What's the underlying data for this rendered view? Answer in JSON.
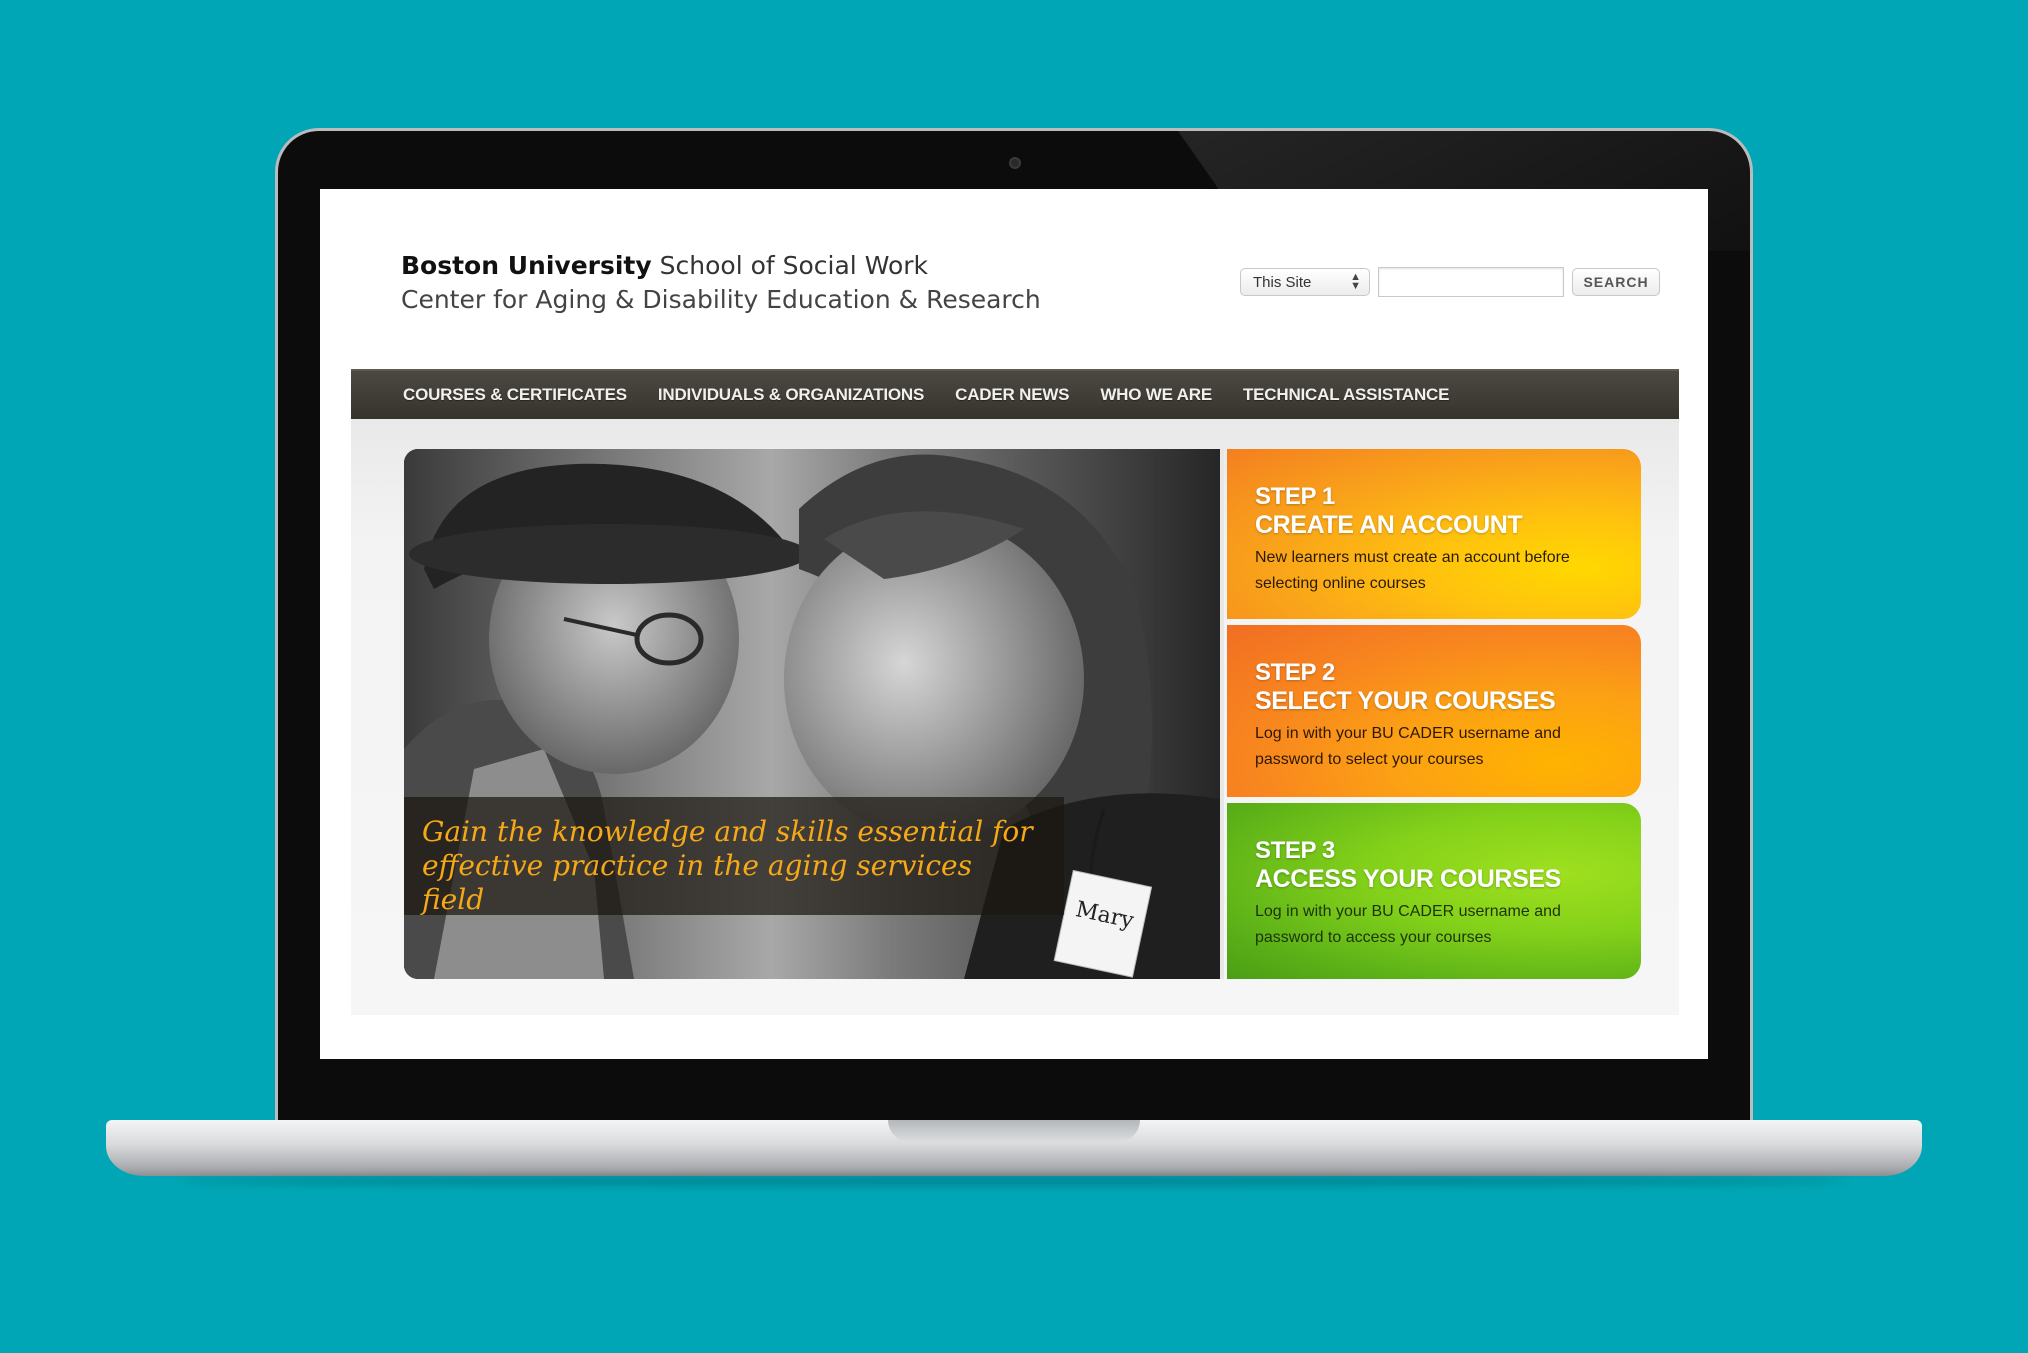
{
  "site": {
    "brand_bold": "Boston University",
    "brand_rest": "School of Social Work",
    "brand_line2": "Center for Aging & Disability Education & Research"
  },
  "search": {
    "scope_value": "This Site",
    "input_value": "",
    "button_label": "SEARCH"
  },
  "nav": {
    "items": [
      {
        "label": "COURSES & CERTIFICATES"
      },
      {
        "label": "INDIVIDUALS & ORGANIZATIONS"
      },
      {
        "label": "CADER NEWS"
      },
      {
        "label": "WHO WE ARE"
      },
      {
        "label": "TECHNICAL ASSISTANCE"
      }
    ]
  },
  "hero": {
    "caption": "Gain the knowledge and skills essential for effective practice in the aging services field",
    "name_tag": "Mary"
  },
  "steps": [
    {
      "number": "STEP 1",
      "title": "CREATE AN ACCOUNT",
      "description": "New learners must create an account before selecting online courses"
    },
    {
      "number": "STEP 2",
      "title": "SELECT YOUR COURSES",
      "description": "Log in with your BU CADER username and password to select your courses"
    },
    {
      "number": "STEP 3",
      "title": "ACCESS YOUR COURSES",
      "description": "Log in with your BU CADER username and password to access your courses"
    }
  ],
  "colors": {
    "background": "#00a6b5",
    "nav_bg": "#3f3c36",
    "caption_text": "#f6a817",
    "step1": "#f9a31a",
    "step2": "#f8861f",
    "step3": "#6cc11a"
  }
}
